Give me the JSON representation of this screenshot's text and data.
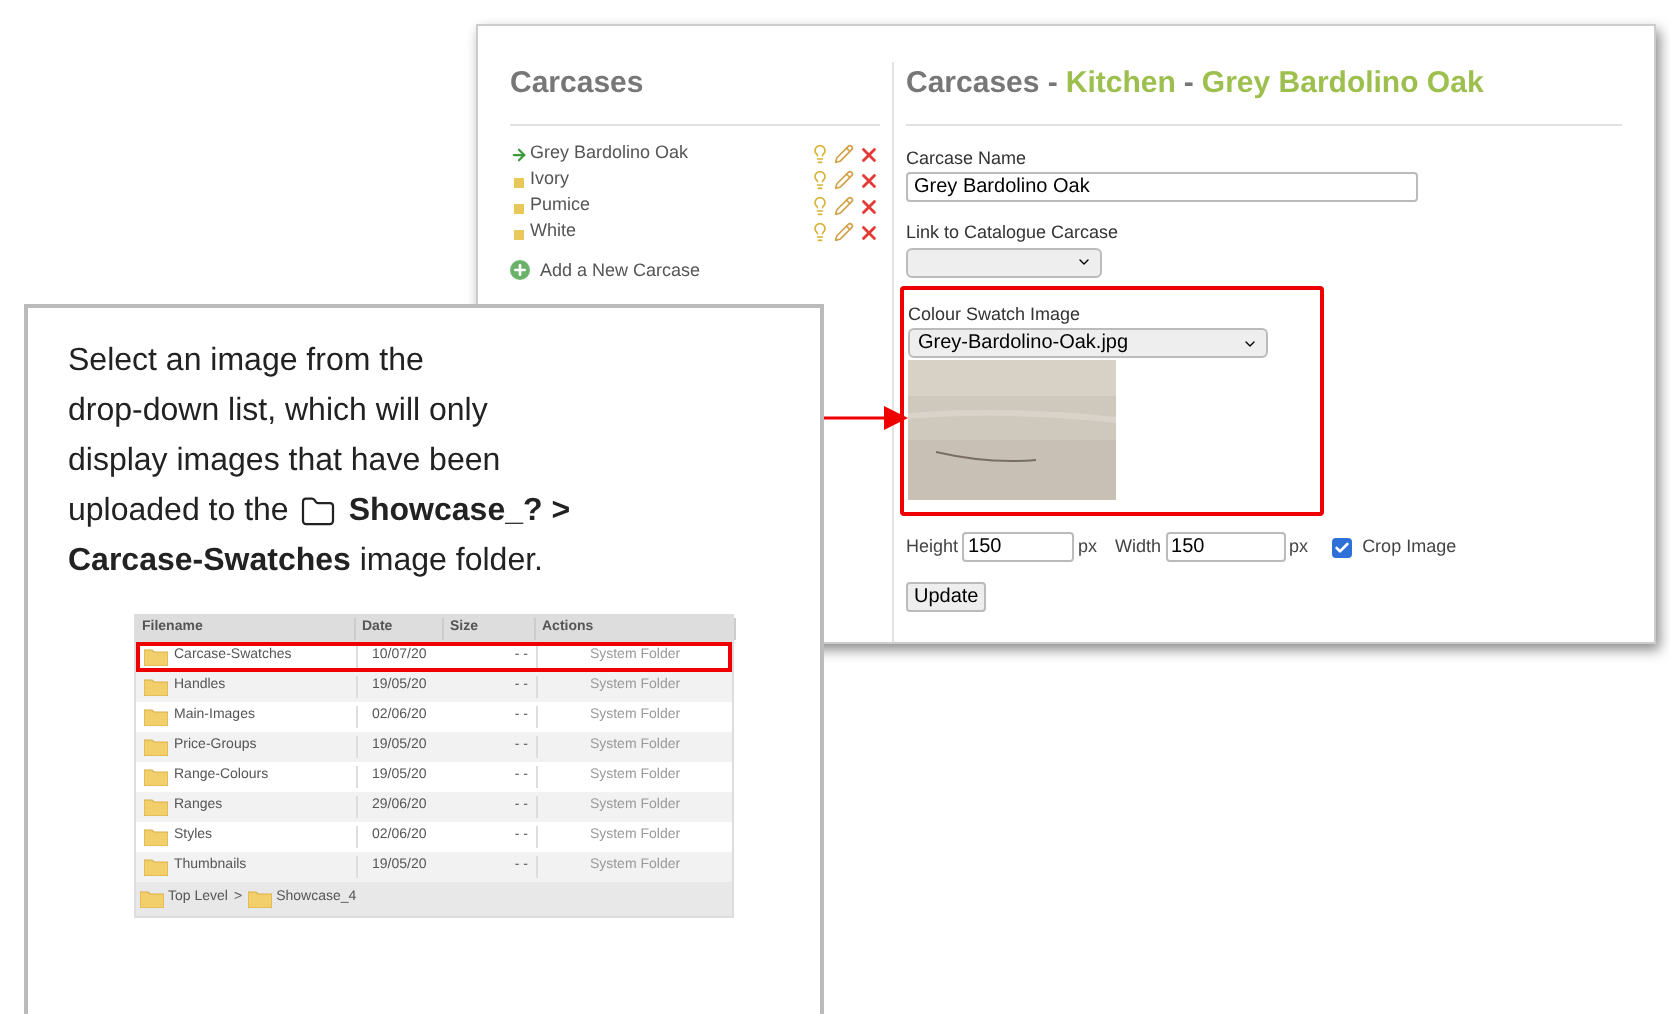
{
  "app_window": {
    "sidebar": {
      "title": "Carcases",
      "items": [
        {
          "label": "Grey Bardolino Oak",
          "selected": true
        },
        {
          "label": "Ivory",
          "selected": false
        },
        {
          "label": "Pumice",
          "selected": false
        },
        {
          "label": "White",
          "selected": false
        }
      ],
      "add_link": "Add a New Carcase"
    },
    "form": {
      "title_parts": [
        {
          "text": "Carcases -",
          "highlighted": false
        },
        {
          "text": "Kitchen",
          "highlighted": true
        },
        {
          "text": "-",
          "highlighted": false
        },
        {
          "text": "Grey Bardolino Oak",
          "highlighted": true
        }
      ],
      "name_label": "Carcase Name",
      "name_value": "Grey Bardolino Oak",
      "link_label": "Link to Catalogue Carcase",
      "swatch_label": "Colour Swatch Image",
      "swatch_value": "Grey-Bardolino-Oak.jpg",
      "swatch_highlighted": true,
      "height_label": "Height",
      "height_value": "150",
      "height_unit": "px",
      "width_label": "Width",
      "width_value": "150",
      "width_unit": "px",
      "crop_label": "Crop Image",
      "crop_checked": true,
      "update_button": "Update"
    }
  },
  "callout": {
    "lines": [
      "Select an image from the",
      "drop-down list, which will only",
      "display images that have been",
      "uploaded to the"
    ],
    "folder_text": "**Showcase_? >**",
    "last_line": "**Carcase-Swatches** image folder.",
    "file_table": {
      "columns": [
        "Filename",
        "Date",
        "Size",
        "Actions"
      ],
      "rows": [
        {
          "name": "Carcase-Swatches",
          "date": "10/07/20",
          "size": "- -",
          "actions": "System Folder",
          "selected": true
        },
        {
          "name": "Handles",
          "date": "19/05/20",
          "size": "- -",
          "actions": "System Folder",
          "selected": false
        },
        {
          "name": "Main-Images",
          "date": "02/06/20",
          "size": "- -",
          "actions": "System Folder",
          "selected": false
        },
        {
          "name": "Price-Groups",
          "date": "19/05/20",
          "size": "- -",
          "actions": "System Folder",
          "selected": false
        },
        {
          "name": "Range-Colours",
          "date": "19/05/20",
          "size": "- -",
          "actions": "System Folder",
          "selected": false
        },
        {
          "name": "Ranges",
          "date": "29/06/20",
          "size": "- -",
          "actions": "System Folder",
          "selected": false
        },
        {
          "name": "Styles",
          "date": "02/06/20",
          "size": "- -",
          "actions": "System Folder",
          "selected": false
        },
        {
          "name": "Thumbnails",
          "date": "19/05/20",
          "size": "- -",
          "actions": "System Folder",
          "selected": false
        }
      ],
      "breadcrumb": [
        "Top Level",
        ">",
        "Showcase_4"
      ]
    }
  }
}
